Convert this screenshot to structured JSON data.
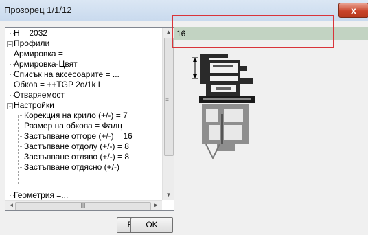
{
  "window": {
    "title": "Прозорец 1/1/12",
    "close_glyph": "x"
  },
  "tree": {
    "items": [
      {
        "label": "H = 2032"
      },
      {
        "label": "Профили",
        "expander": "+"
      },
      {
        "label": "Армировка ="
      },
      {
        "label": "Армировка-Цвят ="
      },
      {
        "label": "Списък на аксесоарите = ..."
      },
      {
        "label": "Обков = ++TGP 2o/1k L"
      },
      {
        "label": "Отваряемост"
      },
      {
        "label": "Настройки",
        "expander": "-"
      },
      {
        "label": "Корекция на крило (+/-) = 7"
      },
      {
        "label": "Размер на обкова = Фалц"
      },
      {
        "label": "Застъпване отгоре (+/-) = 16"
      },
      {
        "label": "Застъпване отдолу (+/-) = 8"
      },
      {
        "label": "Застъпване отляво (+/-) = 8"
      },
      {
        "label": "Застъпване отдясно (+/-) ="
      },
      {
        "label": "Геометрия =..."
      }
    ],
    "hscroll_grip": "III",
    "splitter_mark": "≡"
  },
  "buttons": {
    "all": "Всички",
    "ok": "OK"
  },
  "value_field": {
    "value": "16"
  },
  "colors": {
    "highlight": "#d9343a",
    "value_bg": "#c2d3c2",
    "close_bg": "#c9442a"
  }
}
